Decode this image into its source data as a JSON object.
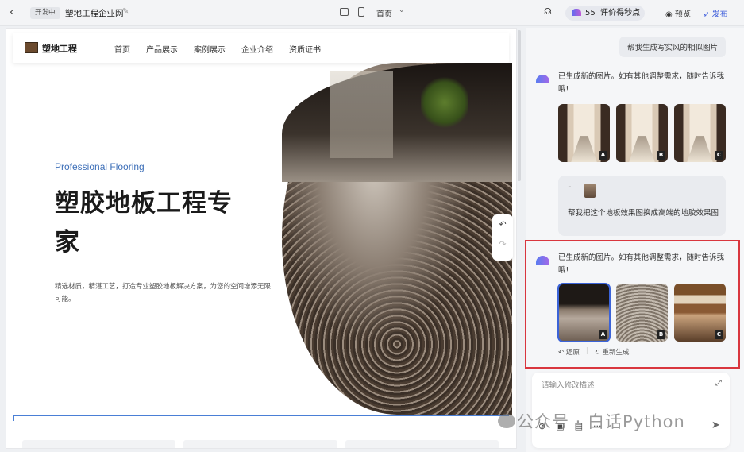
{
  "topbar": {
    "back_icon": "chevron-left-icon",
    "status_badge": "开发中",
    "project_name": "塑地工程企业网",
    "page_select": "首页",
    "credits": "55",
    "credits_label": "评价得秒点",
    "preview": "预览",
    "publish": "发布"
  },
  "site": {
    "logo_text": "塑地工程",
    "nav": [
      "首页",
      "产品展示",
      "案例展示",
      "企业介绍",
      "资质证书"
    ],
    "hero_subtitle": "Professional Flooring",
    "hero_title": "塑胶地板工程专家",
    "hero_desc": "精选材质，精湛工艺，打造专业塑胶地板解决方案，为您的空间增添无限可能。"
  },
  "chat": {
    "user_msg_1": "帮我生成写实风的相似图片",
    "ai_msg_1": "已生成新的图片。如有其他调整需求，随时告诉我哦!",
    "user_msg_2": "帮我把这个地板效果图换成高端的地胶效果图",
    "user_attach_mark": "“",
    "ai_msg_2": "已生成新的图片。如有其他调整需求，随时告诉我哦!",
    "thumb_labels": [
      "A",
      "B",
      "C"
    ],
    "restore": "还原",
    "regenerate": "重新生成",
    "input_placeholder": "请输入修改描述"
  },
  "watermark": "公众号 · 白话Python",
  "colors": {
    "accent": "#3b5bdb",
    "highlight": "#d9363e",
    "hero_subtitle": "#3d6fb8"
  }
}
